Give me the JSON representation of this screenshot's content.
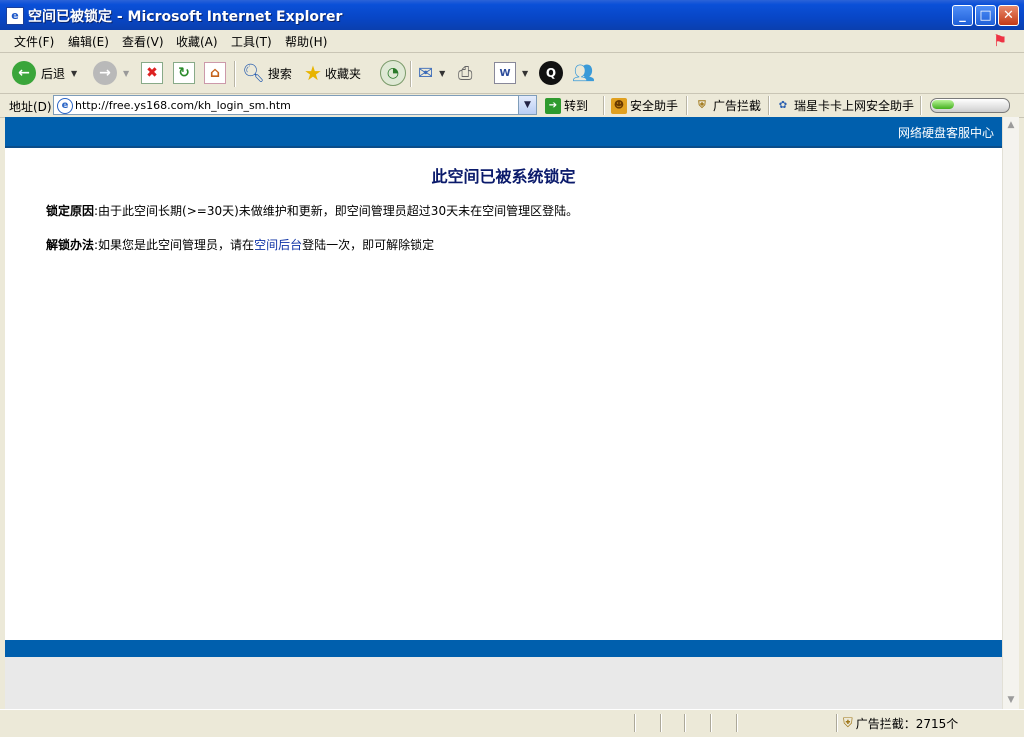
{
  "window": {
    "title": "空间已被锁定 - Microsoft Internet Explorer",
    "icon": "ie-page-icon"
  },
  "menu": [
    "文件(F)",
    "编辑(E)",
    "查看(V)",
    "收藏(A)",
    "工具(T)",
    "帮助(H)"
  ],
  "toolbar": {
    "back_label": "后退",
    "search_label": "搜索",
    "favorites_label": "收藏夹"
  },
  "address": {
    "label": "地址(D)",
    "url": "http://free.ys168.com/kh_login_sm.htm",
    "go_label": "转到",
    "plugins": [
      "安全助手",
      "广告拦截",
      "瑞星卡卡上网安全助手"
    ],
    "meter_fraction": 0.3
  },
  "page": {
    "header_link": "网络硬盘客服中心",
    "title": "此空间已被系统锁定",
    "reason_label": "锁定原因",
    "reason_text": ":由于此空间长期(>=30天)未做维护和更新，即空间管理员超过30天未在空间管理区登陆。",
    "unlock_label": "解锁办法",
    "unlock_prefix": ":如果您是此空间管理员，请在",
    "unlock_link": "空间后台",
    "unlock_suffix": "登陆一次，即可解除锁定",
    "header_color": "#005fad"
  },
  "status": {
    "popup_blocker": "广告拦截：2715个"
  }
}
